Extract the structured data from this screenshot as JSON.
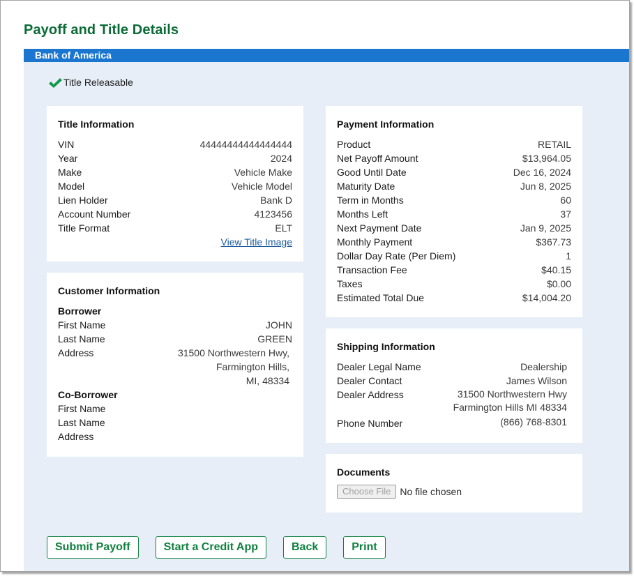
{
  "page": {
    "title": "Payoff and Title Details",
    "bank_name": "Bank of America",
    "status_text": "Title Releasable",
    "colors": {
      "title_green": "#0b6b36",
      "band_blue": "#1a76cf",
      "content_bg": "#e7eef7",
      "check_green": "#109a4a",
      "button_green": "#10813f",
      "link_blue": "#1b5a9e"
    }
  },
  "title_info": {
    "heading": "Title Information",
    "rows": [
      {
        "label": "VIN",
        "value": "44444444444444444"
      },
      {
        "label": "Year",
        "value": "2024"
      },
      {
        "label": "Make",
        "value": "Vehicle Make"
      },
      {
        "label": "Model",
        "value": "Vehicle Model"
      },
      {
        "label": "Lien Holder",
        "value": "Bank D"
      },
      {
        "label": "Account Number",
        "value": "4123456"
      },
      {
        "label": "Title Format",
        "value": "ELT"
      }
    ],
    "link": "View Title Image"
  },
  "customer_info": {
    "heading": "Customer Information",
    "borrower": {
      "heading": "Borrower",
      "first_name_label": "First Name",
      "first_name": "JOHN",
      "last_name_label": "Last Name",
      "last_name": "GREEN",
      "address_label": "Address",
      "address_lines": [
        "31500 Northwestern Hwy,",
        "Farmington Hills,",
        "MI, 48334"
      ]
    },
    "co_borrower": {
      "heading": "Co-Borrower",
      "first_name_label": "First Name",
      "first_name": "",
      "last_name_label": "Last Name",
      "last_name": "",
      "address_label": "Address",
      "address": ""
    }
  },
  "payment_info": {
    "heading": "Payment Information",
    "rows": [
      {
        "label": "Product",
        "value": "RETAIL"
      },
      {
        "label": "Net Payoff Amount",
        "value": "$13,964.05"
      },
      {
        "label": "Good Until Date",
        "value": "Dec 16, 2024"
      },
      {
        "label": "Maturity Date",
        "value": "Jun 8, 2025"
      },
      {
        "label": "Term in Months",
        "value": "60"
      },
      {
        "label": "Months Left",
        "value": "37"
      },
      {
        "label": "Next Payment Date",
        "value": "Jan 9, 2025"
      },
      {
        "label": "Monthly Payment",
        "value": "$367.73"
      },
      {
        "label": "Dollar Day Rate (Per Diem)",
        "value": "1"
      },
      {
        "label": "Transaction Fee",
        "value": "$40.15"
      },
      {
        "label": "Taxes",
        "value": "$0.00"
      },
      {
        "label": "Estimated Total Due",
        "value": "$14,004.20"
      }
    ]
  },
  "shipping_info": {
    "heading": "Shipping Information",
    "dealer_legal_name_label": "Dealer Legal Name",
    "dealer_legal_name": "Dealership",
    "dealer_contact_label": "Dealer Contact",
    "dealer_contact": "James Wilson",
    "dealer_address_label": "Dealer Address",
    "dealer_address_lines": [
      "31500 Northwestern Hwy",
      "Farmington Hills MI 48334"
    ],
    "phone_label": "Phone Number",
    "phone": "(866) 768-8301"
  },
  "documents": {
    "heading": "Documents",
    "choose_file_label": "Choose File",
    "file_status": "No file chosen"
  },
  "actions": {
    "submit_payoff": "Submit Payoff",
    "start_credit_app": "Start a Credit App",
    "back": "Back",
    "print": "Print"
  }
}
